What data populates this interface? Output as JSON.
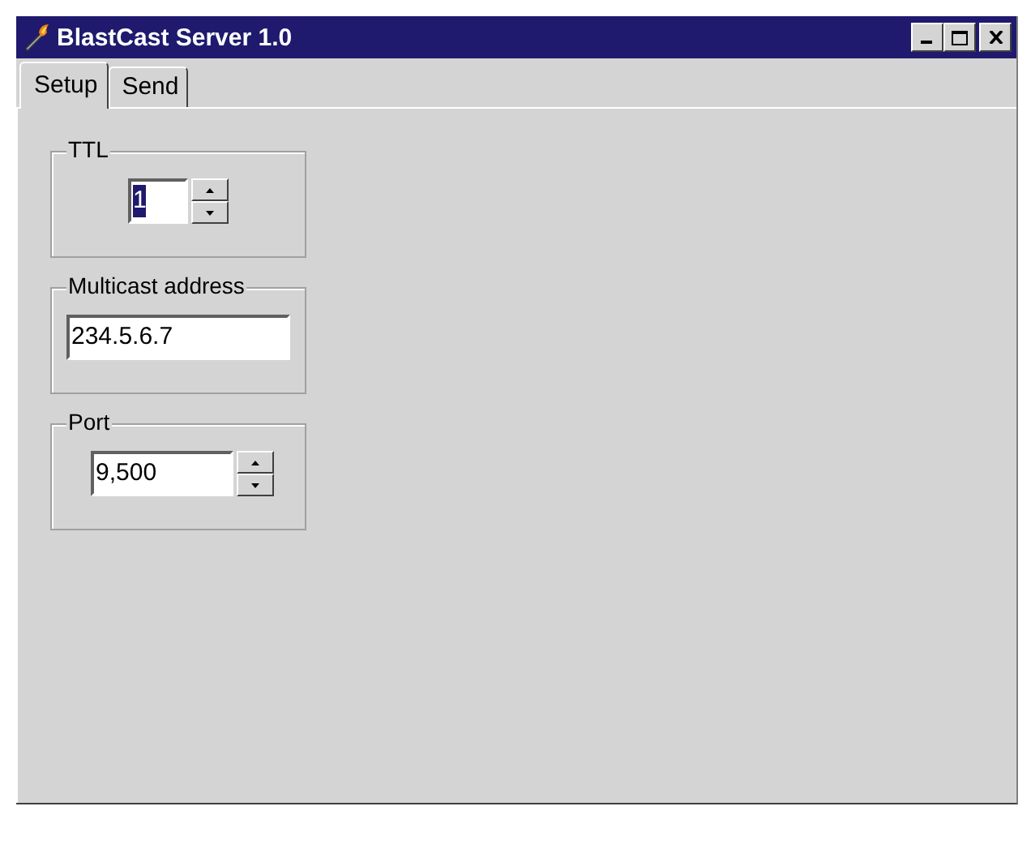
{
  "window": {
    "title": "BlastCast Server 1.0"
  },
  "tabs": [
    {
      "label": "Setup",
      "selected": true
    },
    {
      "label": "Send",
      "selected": false
    }
  ],
  "groups": [
    {
      "label": "TTL",
      "kind": "spinner",
      "value": "1",
      "highlighted": true
    },
    {
      "label": "Multicast address",
      "kind": "text",
      "value": "234.5.6.7",
      "highlighted": false
    },
    {
      "label": "Port",
      "kind": "spinner",
      "value": "9,500",
      "highlighted": false
    }
  ]
}
